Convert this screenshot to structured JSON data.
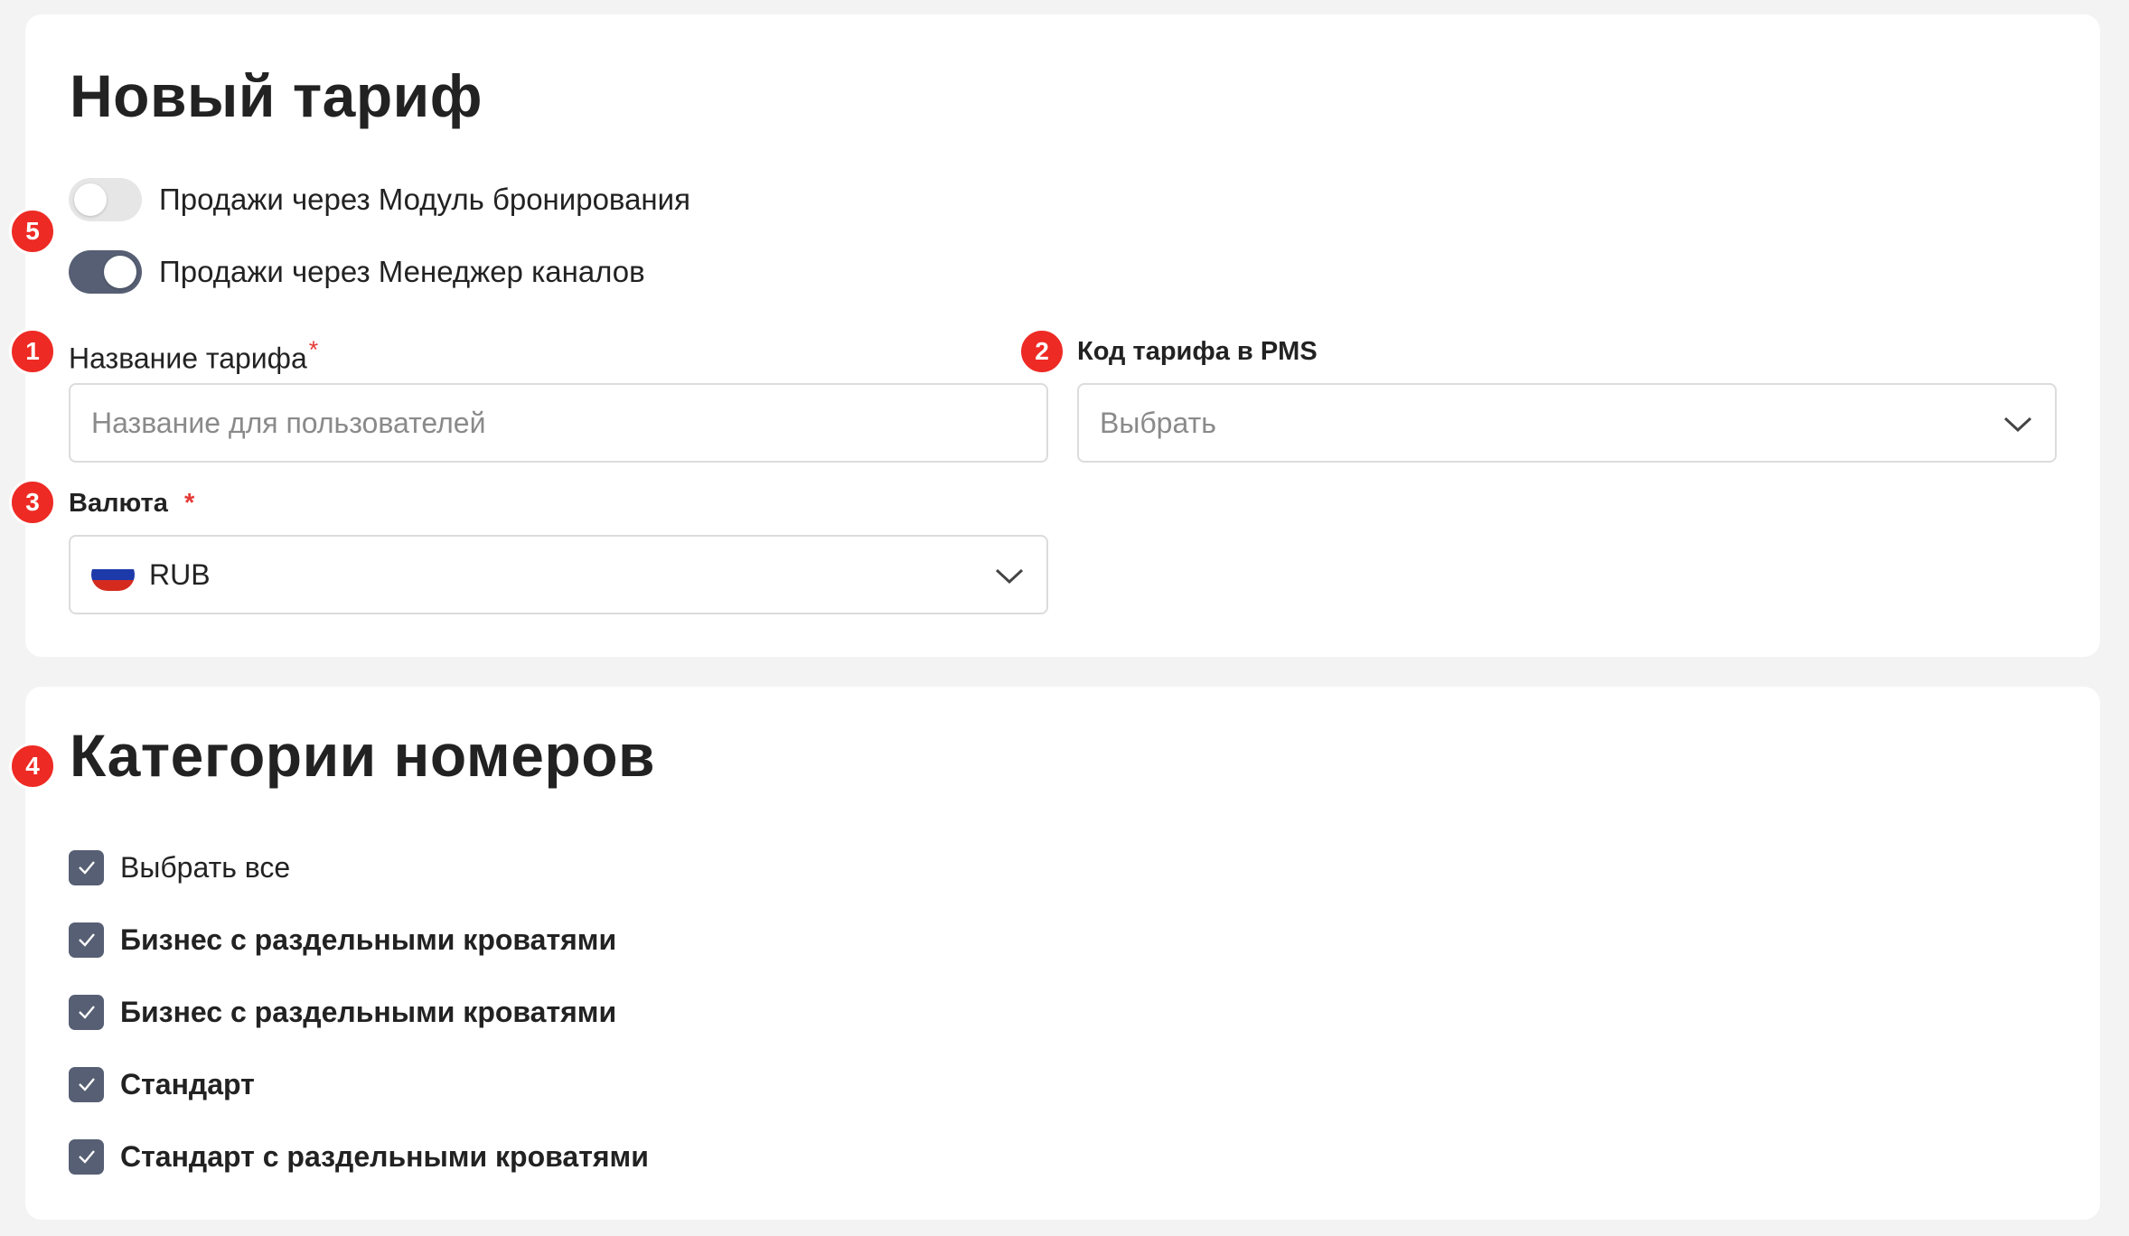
{
  "tariff_card": {
    "title": "Новый тариф",
    "toggles": [
      {
        "label": "Продажи через Модуль бронирования",
        "on": false
      },
      {
        "label": "Продажи через Менеджер каналов",
        "on": true
      }
    ],
    "name_field": {
      "label": "Название тарифа",
      "required_mark": "*",
      "placeholder": "Название для пользователей"
    },
    "pms_code_field": {
      "label": "Код тарифа в PMS",
      "placeholder": "Выбрать"
    },
    "currency_field": {
      "label": "Валюта",
      "required_mark": "*",
      "value": "RUB"
    }
  },
  "categories_card": {
    "title": "Категории номеров",
    "select_all": {
      "label": "Выбрать все",
      "checked": true
    },
    "items": [
      {
        "label": "Бизнес с раздельными кроватями",
        "checked": true
      },
      {
        "label": "Бизнес с раздельными кроватями",
        "checked": true
      },
      {
        "label": "Стандарт",
        "checked": true
      },
      {
        "label": "Стандарт с раздельными кроватями",
        "checked": true
      }
    ]
  },
  "badges": [
    "1",
    "2",
    "3",
    "4",
    "5"
  ],
  "colors": {
    "accent": "#565f73",
    "badge": "#ee2a24",
    "required": "#e53935",
    "background": "#f3f3f3"
  }
}
